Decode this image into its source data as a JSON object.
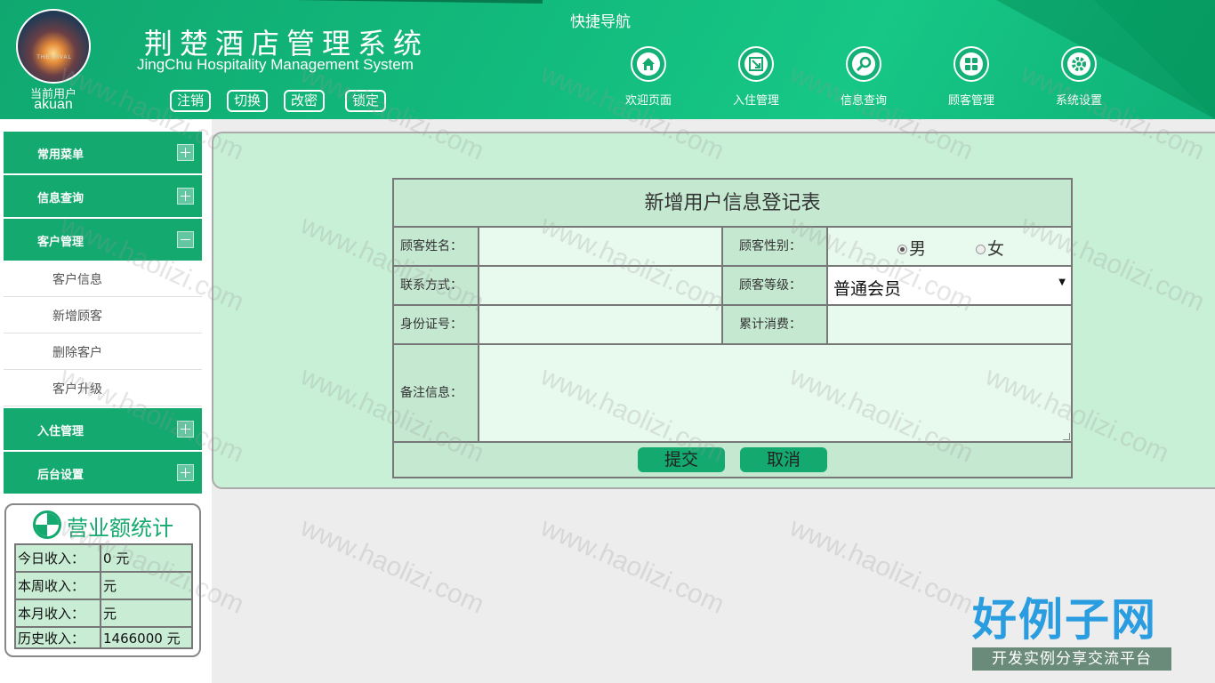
{
  "header": {
    "current_user_label": "当前用户",
    "current_user_name": "akuan",
    "avatar_text": "THE RIVAL",
    "title": "荆楚酒店管理系统",
    "subtitle": "JingChu Hospitality Management System",
    "buttons": [
      "注销",
      "切换",
      "改密",
      "锁定"
    ],
    "quick_nav_title": "快捷导航",
    "nav": [
      {
        "label": "欢迎页面",
        "icon": "home-icon"
      },
      {
        "label": "入住管理",
        "icon": "checkin-icon"
      },
      {
        "label": "信息查询",
        "icon": "search-icon"
      },
      {
        "label": "顾客管理",
        "icon": "grid-icon"
      },
      {
        "label": "系统设置",
        "icon": "gear-icon"
      }
    ]
  },
  "sidebar": {
    "menus": [
      {
        "label": "常用菜单",
        "expanded": false
      },
      {
        "label": "信息查询",
        "expanded": false
      },
      {
        "label": "客户管理",
        "expanded": true
      },
      {
        "label": "入住管理",
        "expanded": false
      },
      {
        "label": "后台设置",
        "expanded": false
      }
    ],
    "customer_submenu": [
      "客户信息",
      "新增顾客",
      "删除客户",
      "客户升级"
    ]
  },
  "stats": {
    "title": "营业额统计",
    "rows": [
      {
        "label": "今日收入：",
        "value": "0 元"
      },
      {
        "label": "本周收入：",
        "value": "元"
      },
      {
        "label": "本月收入：",
        "value": "元"
      },
      {
        "label": "历史收入：",
        "value": "1466000 元"
      }
    ]
  },
  "form": {
    "title": "新增用户信息登记表",
    "name_label": "顾客姓名：",
    "gender_label": "顾客性别：",
    "gender_male": "男",
    "gender_female": "女",
    "gender_selected": "男",
    "phone_label": "联系方式：",
    "level_label": "顾客等级：",
    "level_value": "普通会员",
    "id_label": "身份证号：",
    "spend_label": "累计消费：",
    "remark_label": "备注信息：",
    "submit": "提交",
    "cancel": "取消"
  },
  "watermark": "www.haolizi.com",
  "brand": {
    "name": "好例子网",
    "tagline": "开发实例分享交流平台"
  },
  "colors": {
    "primary": "#13a96f",
    "panel": "#c8f0d6",
    "input": "#e8f9ee"
  }
}
